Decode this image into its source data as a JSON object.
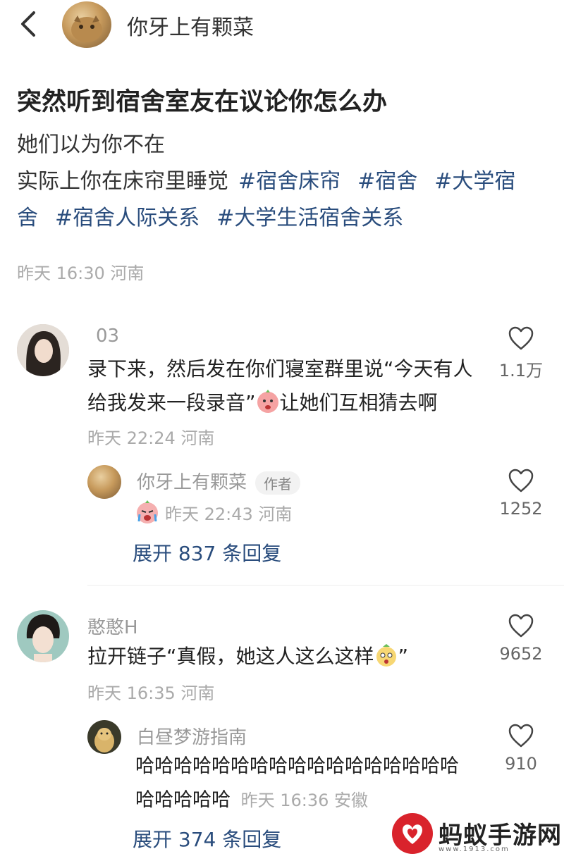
{
  "header": {
    "author_name": "你牙上有颗菜"
  },
  "post": {
    "title": "突然听到宿舍室友在议论你怎么办",
    "line1": "她们以为你不在",
    "line2": "实际上你在床帘里睡觉",
    "tags": [
      "#宿舍床帘",
      "#宿舍",
      "#大学宿舍",
      "#宿舍人际关系",
      "#大学生活宿舍关系"
    ],
    "meta": "昨天 16:30 河南"
  },
  "comments": [
    {
      "username": "03",
      "text_before_emoji": "录下来，然后发在你们寝室群里说“今天有人给我发来一段录音”",
      "text_after_emoji": "让她们互相猜去啊",
      "meta": "昨天 22:24 河南",
      "likes": "1.1万",
      "reply": {
        "username": "你牙上有颗菜",
        "badge": "作者",
        "meta": "昨天 22:43 河南",
        "likes": "1252"
      },
      "expand_label": "展开 837 条回复"
    },
    {
      "username": "憨憨H",
      "text_before_emoji": "拉开链子“真假，她这人这么这样",
      "text_after_emoji": "”",
      "meta": "昨天 16:35 河南",
      "likes": "9652",
      "reply": {
        "username": "白昼梦游指南",
        "text": "哈哈哈哈哈哈哈哈哈哈哈哈哈哈哈哈哈哈哈哈哈哈",
        "meta": "昨天 16:36 安徽",
        "likes": "910"
      },
      "expand_label": "展开 374 条回复"
    }
  ],
  "watermark": {
    "text": "蚂蚁手游网",
    "url": "www.1913.com"
  },
  "colors": {
    "tag": "#2a4d7d",
    "meta": "#aaaaaa",
    "watermark_red": "#d9232c"
  }
}
